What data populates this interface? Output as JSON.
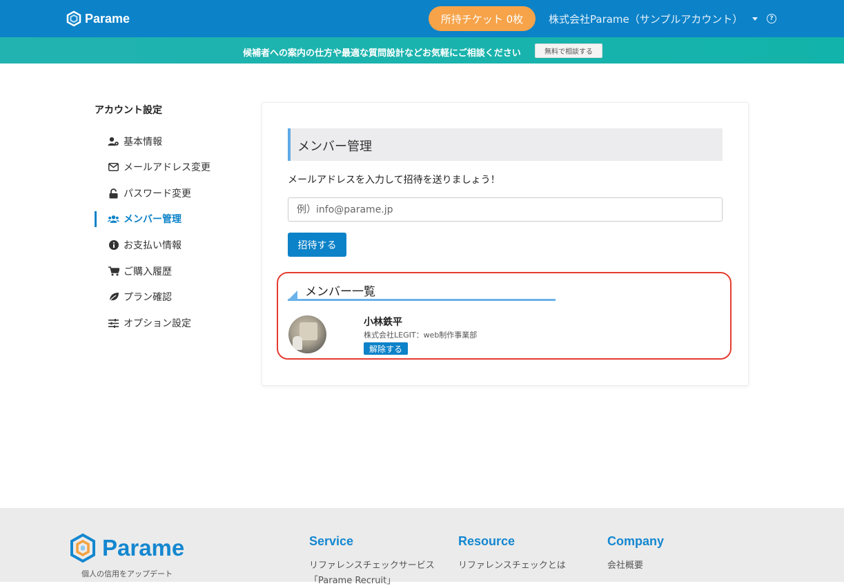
{
  "header": {
    "brand": "Parame",
    "ticket_button": "所持チケット 0枚",
    "account_name": "株式会社Parame（サンプルアカウント）",
    "help_icon": "question-circle-icon",
    "bg_color": "#0c82c8",
    "ticket_color": "#f6a34a"
  },
  "banner": {
    "text": "候補者への案内の仕方や最適な質問設計などお気軽にご相談ください",
    "button": "無料で相談する"
  },
  "sidebar": {
    "title": "アカウント設定",
    "items": [
      {
        "label": "基本情報",
        "icon": "user-gear-icon",
        "glyph": "👤"
      },
      {
        "label": "メールアドレス変更",
        "icon": "envelope-icon",
        "glyph": "✉"
      },
      {
        "label": "パスワード変更",
        "icon": "unlock-icon",
        "glyph": "🔓"
      },
      {
        "label": "メンバー管理",
        "icon": "users-icon",
        "glyph": "👥"
      },
      {
        "label": "お支払い情報",
        "icon": "info-circle-icon",
        "glyph": "ℹ"
      },
      {
        "label": "ご購入履歴",
        "icon": "cart-icon",
        "glyph": "🛒"
      },
      {
        "label": "プラン確認",
        "icon": "leaf-icon",
        "glyph": "🍃"
      },
      {
        "label": "オプション設定",
        "icon": "sliders-icon",
        "glyph": "☰"
      }
    ],
    "active_index": 3
  },
  "main": {
    "section_title": "メンバー管理",
    "description": "メールアドレスを入力して招待を送りましょう！",
    "email_placeholder": "例）info@parame.jp",
    "invite_button": "招待する",
    "list_title": "メンバー一覧",
    "members": [
      {
        "name": "小林鉄平",
        "organization": "株式会社LEGIT：web制作事業部",
        "remove_label": "解除する"
      }
    ]
  },
  "footer": {
    "brand": "Parame",
    "tagline": "個人の信用をアップデート",
    "columns": [
      {
        "title": "Service",
        "links": [
          "リファレンスチェックサービス",
          "「Parame Recruit」"
        ]
      },
      {
        "title": "Resource",
        "links": [
          "リファレンスチェックとは"
        ]
      },
      {
        "title": "Company",
        "links": [
          "会社概要"
        ]
      }
    ]
  }
}
